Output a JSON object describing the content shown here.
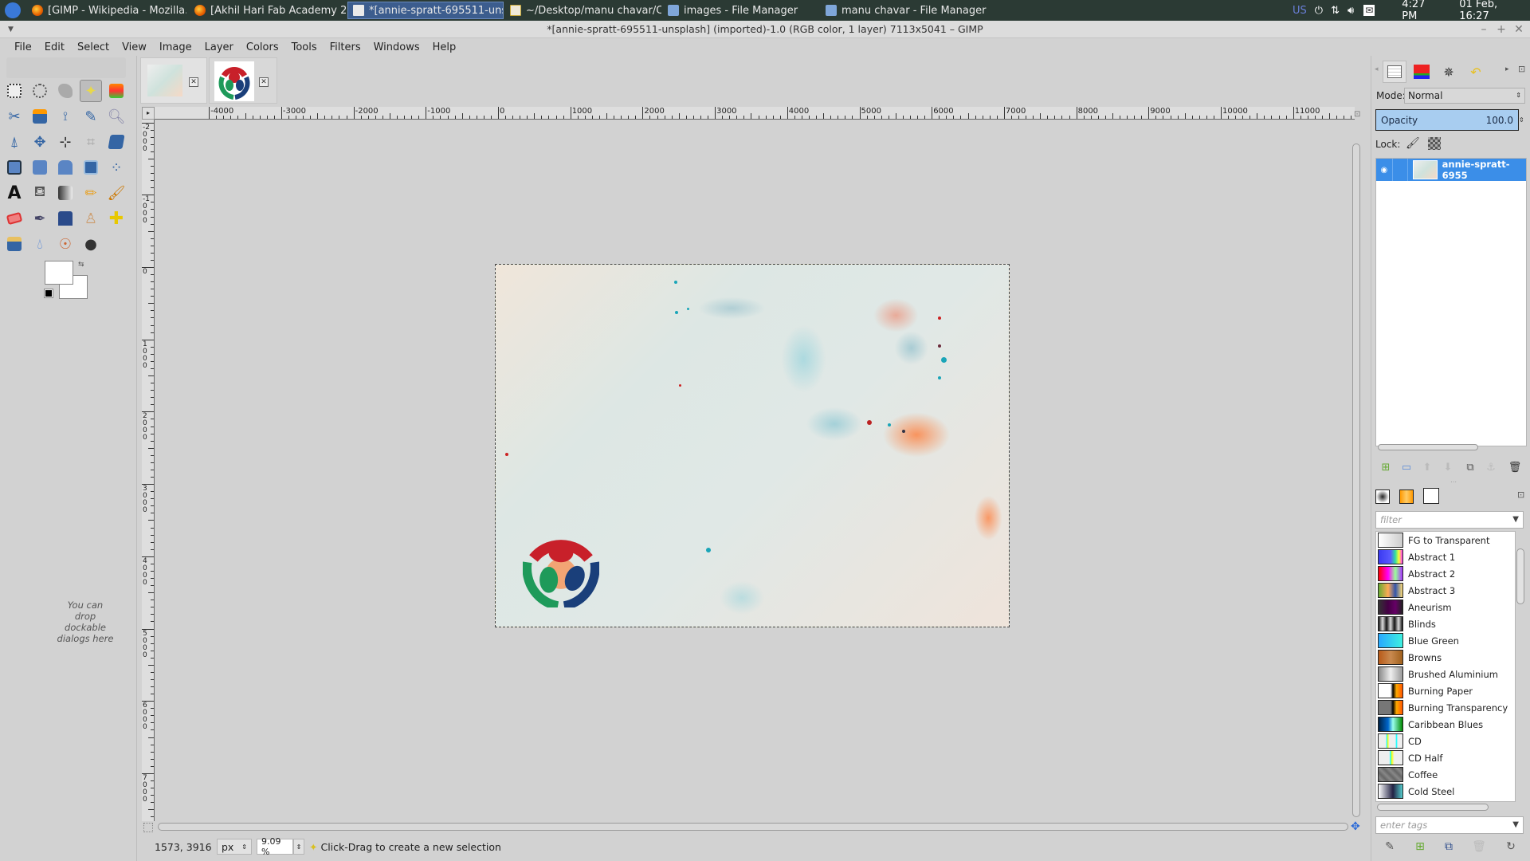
{
  "taskbar": {
    "tasks": [
      {
        "label": "[GIMP - Wikipedia - Mozilla...",
        "icon": "firefox-icon"
      },
      {
        "label": "[Akhil Hari Fab Academy 2...",
        "icon": "firefox-icon"
      },
      {
        "label": "*[annie-spratt-695511-uns...",
        "icon": "gimp-window-icon",
        "active": true
      },
      {
        "label": "~/Desktop/manu chavar/C...",
        "icon": "terminal-icon"
      },
      {
        "label": "images - File Manager",
        "icon": "folder-icon"
      },
      {
        "label": "manu chavar - File Manager",
        "icon": "folder-icon"
      }
    ],
    "keyboard_layout": "US",
    "time": "4:27 PM",
    "date": "01 Feb, 16:27"
  },
  "window": {
    "title": "*[annie-spratt-695511-unsplash] (imported)-1.0 (RGB color, 1 layer) 7113x5041 – GIMP"
  },
  "menu": [
    "File",
    "Edit",
    "Select",
    "View",
    "Image",
    "Layer",
    "Colors",
    "Tools",
    "Filters",
    "Windows",
    "Help"
  ],
  "toolbox": {
    "dock_hint": "You can drop dockable dialogs here",
    "selected_tool": "fuzzy-select"
  },
  "rulers": {
    "top": [
      "-4000",
      "-3000",
      "-2000",
      "-1000",
      "0",
      "1000",
      "2000",
      "3000",
      "4000",
      "5000",
      "6000",
      "7000",
      "8000",
      "9000",
      "10000",
      "11000"
    ],
    "left": [
      "-2000",
      "-1000",
      "0",
      "1000",
      "2000",
      "3000",
      "4000",
      "5000",
      "6000",
      "7000"
    ]
  },
  "statusbar": {
    "coords": "1573, 3916",
    "unit": "px",
    "zoom": "9.09 %",
    "message": "Click-Drag to create a new selection"
  },
  "layers": {
    "mode_label": "Mode:",
    "mode_value": "Normal",
    "opacity_label": "Opacity",
    "opacity_value": "100.0",
    "lock_label": "Lock:",
    "layer_name": "annie-spratt-6955"
  },
  "gradients": {
    "filter_placeholder": "filter",
    "tags_placeholder": "enter tags",
    "items": [
      {
        "name": "FG to Transparent",
        "preview": "linear-gradient(90deg,#fff,#ccc)"
      },
      {
        "name": "Abstract 1",
        "preview": "linear-gradient(90deg,#3a3af0,#5a5aff 50%,#30e0a0 70%,#ff3 85%,#f3f 100%)"
      },
      {
        "name": "Abstract 2",
        "preview": "linear-gradient(90deg,#f00,#f0f 40%,#9f9 70%,#a3f 100%)"
      },
      {
        "name": "Abstract 3",
        "preview": "linear-gradient(90deg,#6a3,#fa5 40%,#35a 70%,#fd7 100%)"
      },
      {
        "name": "Aneurism",
        "preview": "linear-gradient(90deg,#333,#404 40%,#606 70%,#222 100%)"
      },
      {
        "name": "Blinds",
        "preview": "repeating-linear-gradient(90deg,#111 0,#ddd 5px,#111 10px)"
      },
      {
        "name": "Blue Green",
        "preview": "linear-gradient(90deg,#28a8ff,#3ef0e0)"
      },
      {
        "name": "Browns",
        "preview": "linear-gradient(90deg,#b85a18,#c98a50 50%,#a0601c 100%)"
      },
      {
        "name": "Brushed Aluminium",
        "preview": "linear-gradient(90deg,#888,#eee 50%,#999 100%)"
      },
      {
        "name": "Burning Paper",
        "preview": "linear-gradient(90deg,#fff 50%,#000 60%,#fa0 75%,#f50 100%)"
      },
      {
        "name": "Burning Transparency",
        "preview": "linear-gradient(90deg,#777 50%,#000 60%,#fa0 75%,#f50 100%)"
      },
      {
        "name": "Caribbean Blues",
        "preview": "linear-gradient(90deg,#024,#06c 40%,#9fe 60%,#080 100%)"
      },
      {
        "name": "CD",
        "preview": "linear-gradient(90deg,#eee 30%,#0ff 35%,#ff0 38%,#eee 45%,#eee 70%,#0ff 75%,#eee 80%)"
      },
      {
        "name": "CD Half",
        "preview": "linear-gradient(90deg,#eee 45%,#0ff 50%,#ff0 55%,#eee 65%)"
      },
      {
        "name": "Coffee",
        "preview": "repeating-linear-gradient(45deg,#666 0,#888 4px,#666 8px)"
      },
      {
        "name": "Cold Steel",
        "preview": "linear-gradient(90deg,#fff,#224 60%,#5cc 100%)"
      }
    ]
  }
}
